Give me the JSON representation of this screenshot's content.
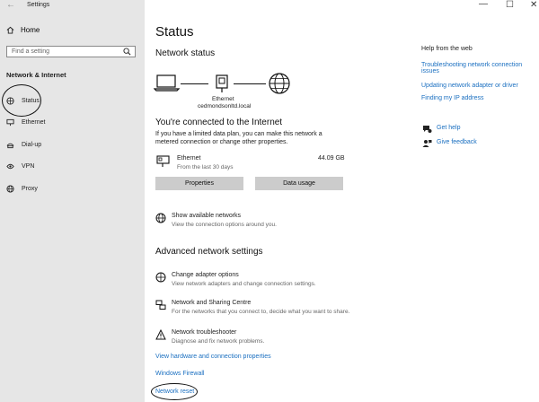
{
  "window": {
    "title": "Settings",
    "back_glyph": "←",
    "min_glyph": "—",
    "max_glyph": "☐",
    "close_glyph": "✕"
  },
  "sidebar": {
    "home_label": "Home",
    "search_placeholder": "Find a setting",
    "section_title": "Network & Internet",
    "items": [
      {
        "label": "Status",
        "icon": "status-icon"
      },
      {
        "label": "Ethernet",
        "icon": "ethernet-icon"
      },
      {
        "label": "Dial-up",
        "icon": "dialup-icon"
      },
      {
        "label": "VPN",
        "icon": "vpn-icon"
      },
      {
        "label": "Proxy",
        "icon": "proxy-icon"
      }
    ]
  },
  "main": {
    "title": "Status",
    "network_status_heading": "Network status",
    "diagram": {
      "adapter_label": "Ethernet",
      "network_name": "cedmondsonltd.local"
    },
    "connected_heading": "You're connected to the Internet",
    "connected_desc_line1": "If you have a limited data plan, you can make this network a",
    "connected_desc_line2": "metered connection or change other properties.",
    "usage": {
      "name": "Ethernet",
      "period": "From the last 30 days",
      "amount": "44.09 GB"
    },
    "properties_button": "Properties",
    "data_usage_button": "Data usage",
    "show_networks": {
      "title": "Show available networks",
      "desc": "View the connection options around you."
    },
    "advanced_heading": "Advanced network settings",
    "advanced_items": [
      {
        "title": "Change adapter options",
        "desc": "View network adapters and change connection settings."
      },
      {
        "title": "Network and Sharing Centre",
        "desc": "For the networks that you connect to, decide what you want to share."
      },
      {
        "title": "Network troubleshooter",
        "desc": "Diagnose and fix network problems."
      }
    ],
    "links": {
      "hardware": "View hardware and connection properties",
      "firewall": "Windows Firewall",
      "reset": "Network reset"
    }
  },
  "help": {
    "heading": "Help from the web",
    "link1_line1": "Troubleshooting network connection",
    "link1_line2": "issues",
    "link2": "Updating network adapter or driver",
    "link3": "Finding my IP address",
    "get_help": "Get help",
    "give_feedback": "Give feedback"
  }
}
